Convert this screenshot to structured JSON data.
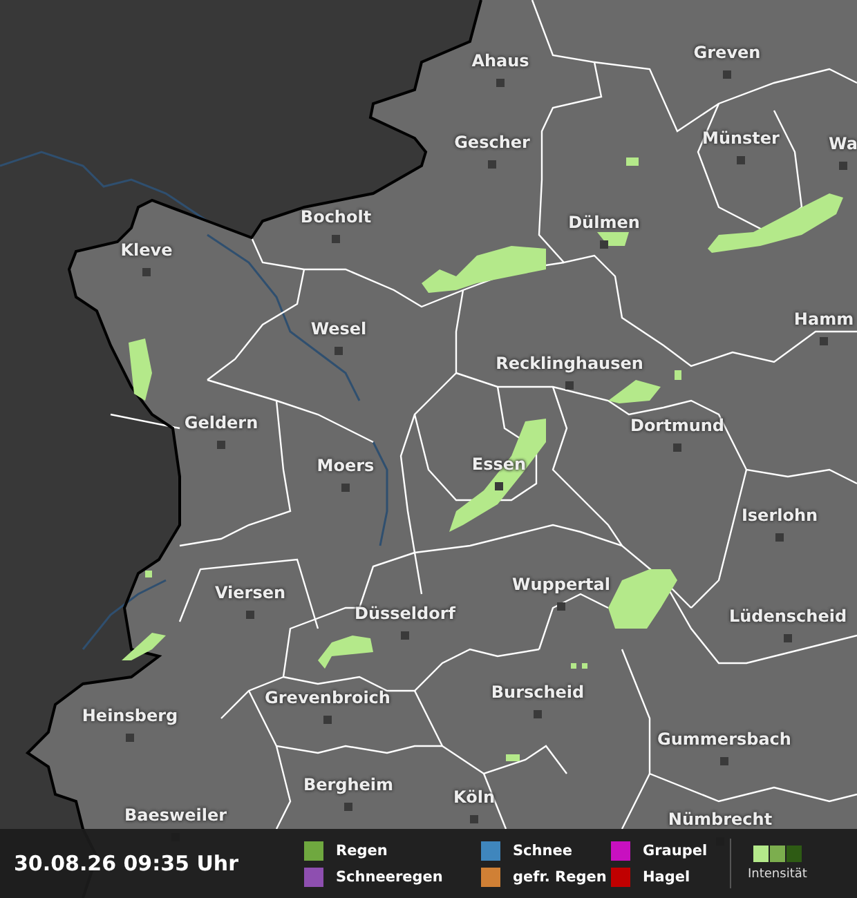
{
  "map": {
    "cities": [
      {
        "name": "Ahaus"
      },
      {
        "name": "Greven"
      },
      {
        "name": "Gescher"
      },
      {
        "name": "Münster"
      },
      {
        "name": "Wa"
      },
      {
        "name": "Bocholt"
      },
      {
        "name": "Dülmen"
      },
      {
        "name": "Kleve"
      },
      {
        "name": "Wesel"
      },
      {
        "name": "Hamm"
      },
      {
        "name": "Recklinghausen"
      },
      {
        "name": "Geldern"
      },
      {
        "name": "Dortmund"
      },
      {
        "name": "Moers"
      },
      {
        "name": "Essen"
      },
      {
        "name": "Iserlohn"
      },
      {
        "name": "Wuppertal"
      },
      {
        "name": "Viersen"
      },
      {
        "name": "Düsseldorf"
      },
      {
        "name": "Lüdenscheid"
      },
      {
        "name": "Grevenbroich"
      },
      {
        "name": "Burscheid"
      },
      {
        "name": "Heinsberg"
      },
      {
        "name": "Gummersbach"
      },
      {
        "name": "Bergheim"
      },
      {
        "name": "Köln"
      },
      {
        "name": "Baesweiler"
      },
      {
        "name": "Nümbrecht"
      }
    ]
  },
  "status_bar": {
    "timestamp": "30.08.26 09:35 Uhr",
    "legend": [
      {
        "label": "Regen",
        "color": "#6fa83f"
      },
      {
        "label": "Schnee",
        "color": "#3f86bd"
      },
      {
        "label": "Graupel",
        "color": "#c810c0"
      },
      {
        "label": "Schneeregen",
        "color": "#8e4fb0"
      },
      {
        "label": "gefr. Regen",
        "color": "#d08035"
      },
      {
        "label": "Hagel",
        "color": "#c00000"
      }
    ],
    "intensity": {
      "label": "Intensität",
      "swatches": [
        {
          "color": "#b4e98a"
        },
        {
          "color": "#7cae4e"
        },
        {
          "color": "#2e5b14"
        }
      ]
    }
  }
}
